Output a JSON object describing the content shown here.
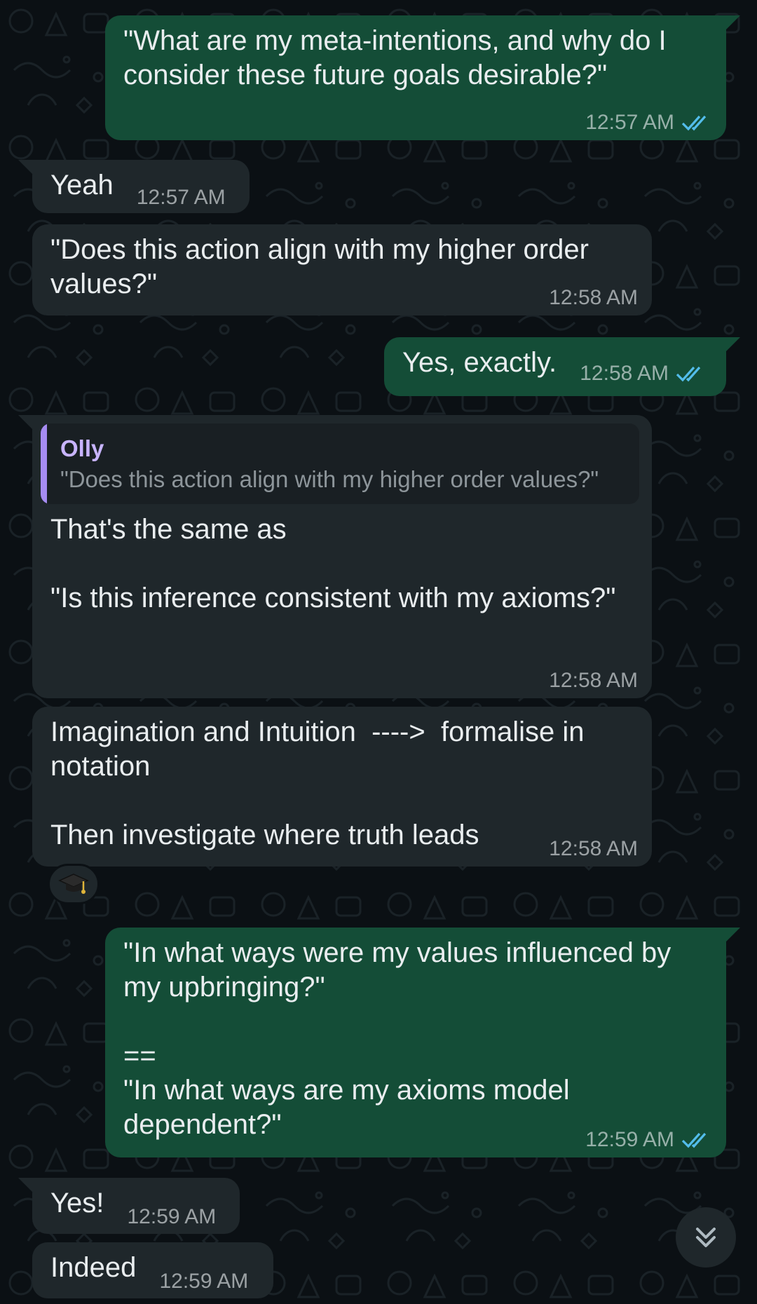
{
  "colors": {
    "outgoing": "#144d37",
    "incoming": "#1f272b",
    "background": "#0b1014",
    "read_ticks": "#53bdeb",
    "quote_accent": "#a68cf2"
  },
  "messages": [
    {
      "direction": "out",
      "text": "\"What are my meta-intentions, and why do I consider these future goals desirable?\"",
      "time": "12:57 AM",
      "status": "read"
    },
    {
      "direction": "in",
      "text": "Yeah",
      "time": "12:57 AM"
    },
    {
      "direction": "in",
      "text": "\"Does this action align with my higher order values?\"",
      "time": "12:58 AM"
    },
    {
      "direction": "out",
      "text": "Yes, exactly.",
      "time": "12:58 AM",
      "status": "read"
    },
    {
      "direction": "in",
      "quote": {
        "author": "Olly",
        "text": "\"Does this action align with my higher order values?\""
      },
      "text": "That's the same as\n\n\"Is this inference consistent with my axioms?\"",
      "time": "12:58 AM"
    },
    {
      "direction": "in",
      "text": "Imagination and Intuition  ---->  formalise in notation\n\nThen investigate where truth leads",
      "time": "12:58 AM",
      "reaction": "graduation-cap-icon"
    },
    {
      "direction": "out",
      "text": "\"In what ways were my values influenced by my upbringing?\"\n\n==\n\"In what ways are my axioms model dependent?\"",
      "time": "12:59 AM",
      "status": "read"
    },
    {
      "direction": "in",
      "text": "Yes!",
      "time": "12:59 AM"
    },
    {
      "direction": "in",
      "text": "Indeed",
      "time": "12:59 AM"
    }
  ],
  "scroll_button": {
    "icon": "double-chevron-down-icon"
  }
}
